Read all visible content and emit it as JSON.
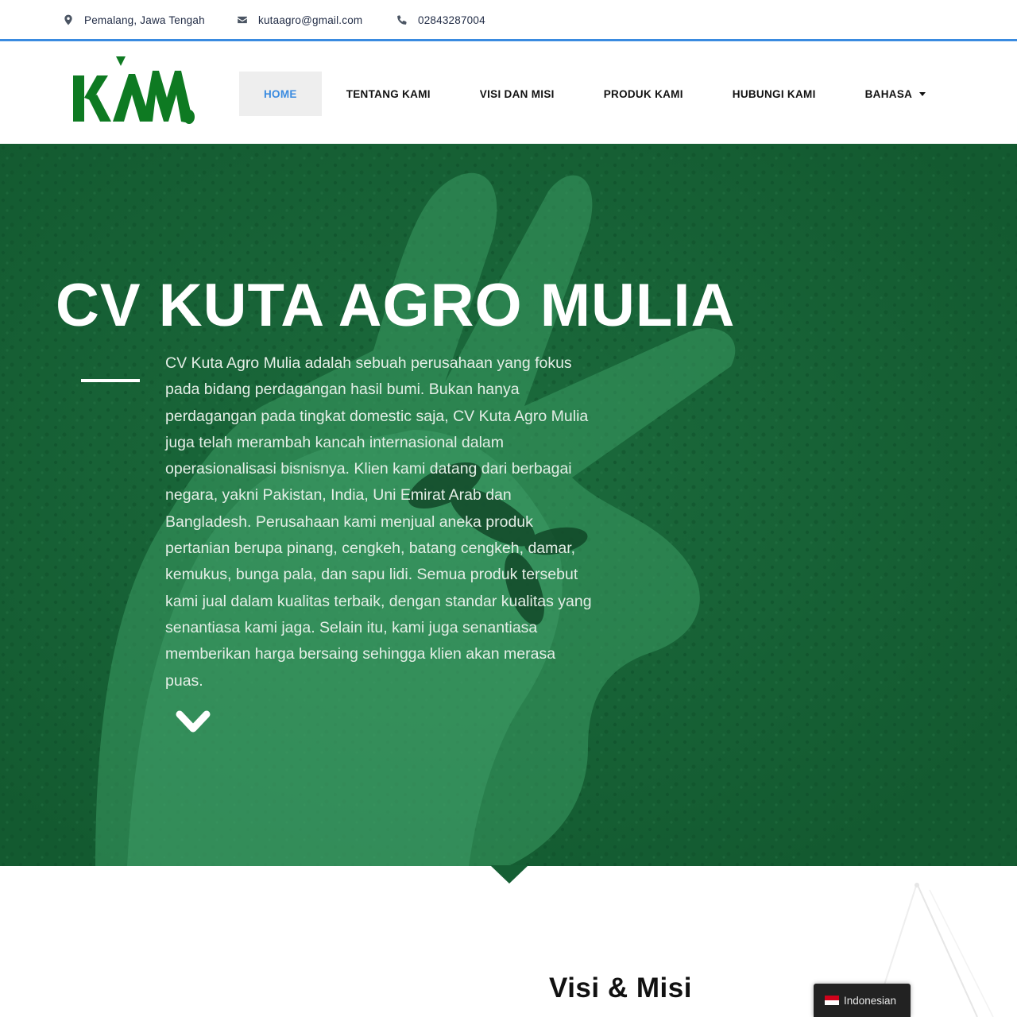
{
  "topbar": {
    "location": "Pemalang, Jawa Tengah",
    "email": "kutaagro@gmail.com",
    "phone": "02843287004"
  },
  "logo": {
    "text": "KAM",
    "color": "#0e7a22"
  },
  "nav": {
    "items": [
      {
        "label": "HOME",
        "active": true
      },
      {
        "label": "TENTANG KAMI"
      },
      {
        "label": "VISI DAN MISI"
      },
      {
        "label": "PRODUK KAMI"
      },
      {
        "label": "HUBUNGI KAMI"
      },
      {
        "label": "BAHASA"
      }
    ]
  },
  "hero": {
    "title": "CV KUTA AGRO MULIA",
    "description": "CV Kuta Agro Mulia adalah sebuah perusahaan yang fokus pada bidang perdagangan hasil bumi. Bukan hanya perdagangan pada tingkat domestic saja, CV Kuta Agro Mulia juga telah merambah kancah internasional dalam operasionalisasi bisnisnya. Klien kami datang dari berbagai negara, yakni Pakistan, India, Uni Emirat Arab dan Bangladesh. Perusahaan kami menjual aneka produk pertanian berupa pinang, cengkeh, batang cengkeh, damar, kemukus, bunga pala, dan sapu lidi. Semua produk tersebut kami jual dalam kualitas terbaik, dengan standar kualitas yang senantiasa kami jaga. Selain itu, kami juga senantiasa memberikan harga bersaing sehingga klien akan merasa puas.",
    "overlay_color": "#155f34"
  },
  "section": {
    "title": "Visi & Misi"
  },
  "language_switcher": {
    "label": "Indonesian"
  },
  "colors": {
    "accent": "#3a8be0",
    "hero_green": "#155f34",
    "logo_green": "#0e7a22"
  }
}
